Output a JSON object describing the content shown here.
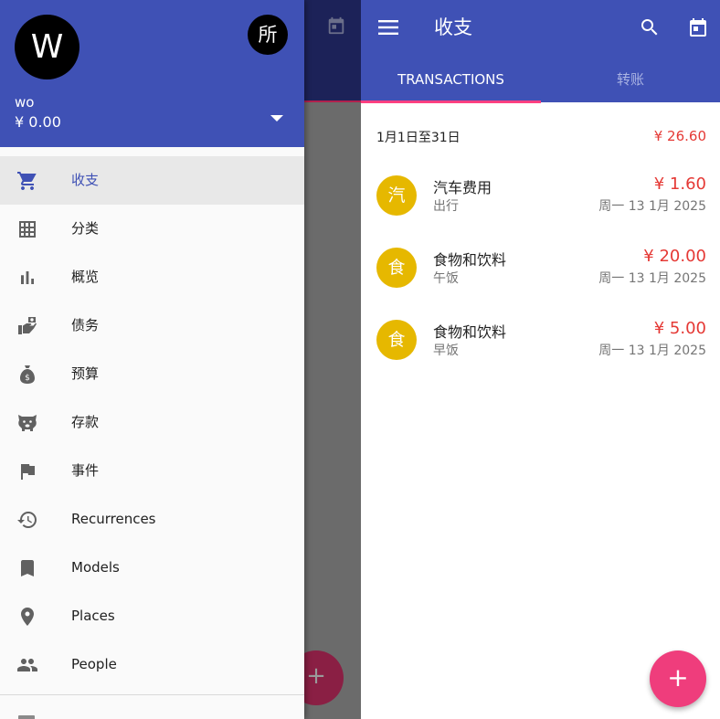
{
  "drawer": {
    "avatar_letter": "W",
    "account_badge": "所",
    "user_name": "wo",
    "balance": "¥ 0.00",
    "items": [
      {
        "label": "收支",
        "icon": "cart-icon",
        "active": true
      },
      {
        "label": "分类",
        "icon": "grid-icon"
      },
      {
        "label": "概览",
        "icon": "bar-chart-icon"
      },
      {
        "label": "债务",
        "icon": "debt-hand-icon"
      },
      {
        "label": "预算",
        "icon": "money-bag-icon"
      },
      {
        "label": "存款",
        "icon": "piggy-bank-icon"
      },
      {
        "label": "事件",
        "icon": "flag-icon"
      },
      {
        "label": "Recurrences",
        "icon": "history-icon"
      },
      {
        "label": "Models",
        "icon": "bookmark-icon"
      },
      {
        "label": "Places",
        "icon": "location-pin-icon"
      },
      {
        "label": "People",
        "icon": "people-icon"
      }
    ]
  },
  "appbar": {
    "title": "收支"
  },
  "tabs": [
    {
      "label": "TRANSACTIONS",
      "active": true
    },
    {
      "label": "转账",
      "active": false
    }
  ],
  "summary": {
    "period": "1月1日至31日",
    "total": "¥ 26.60"
  },
  "transactions": [
    {
      "avatar": "汽",
      "category": "汽车费用",
      "note": "出行",
      "amount": "¥ 1.60",
      "date": "周一 13 1月 2025"
    },
    {
      "avatar": "食",
      "category": "食物和饮料",
      "note": "午饭",
      "amount": "¥ 20.00",
      "date": "周一 13 1月 2025"
    },
    {
      "avatar": "食",
      "category": "食物和饮料",
      "note": "早饭",
      "amount": "¥ 5.00",
      "date": "周一 13 1月 2025"
    }
  ],
  "fab": {
    "icon": "plus-icon",
    "label": "+"
  },
  "colors": {
    "primary": "#3f51b5",
    "accent": "#ff4081",
    "expense": "#e53935",
    "category_avatar": "#e6b800"
  }
}
